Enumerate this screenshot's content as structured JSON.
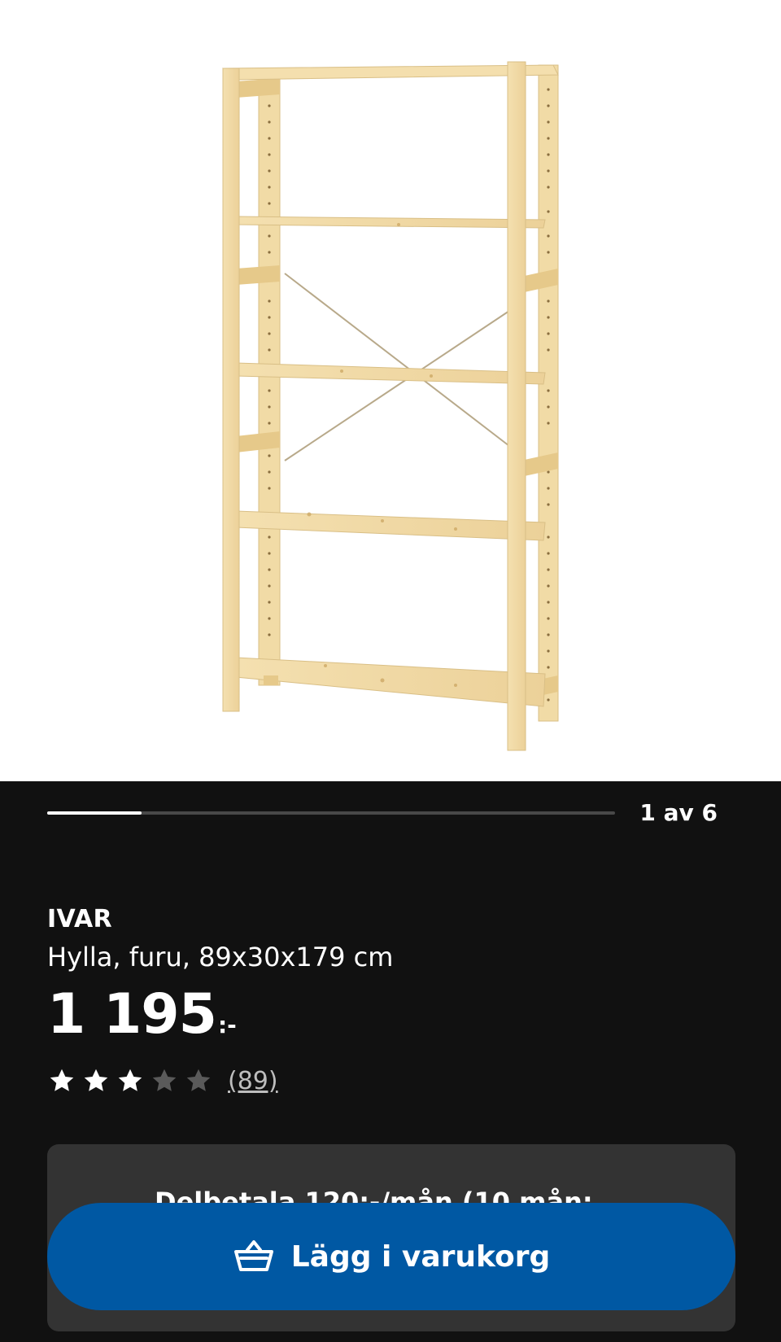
{
  "product_image": {
    "icon": "ivar-shelf-image"
  },
  "carousel": {
    "counter": "1 av 6",
    "current": 1,
    "total": 6
  },
  "product": {
    "brand": "IVAR",
    "description": "Hylla, furu, 89x30x179 cm",
    "price_integer": "1 195",
    "price_suffix": ":-",
    "rating_value": 3,
    "rating_max": 5,
    "review_count": "(89)"
  },
  "installment": {
    "text": "Delbetala 120:-/mån (10 mån;"
  },
  "cart_button": {
    "label": "Lägg i varukorg",
    "icon": "basket-icon"
  },
  "colors": {
    "background": "#111111",
    "button": "#0058a3",
    "card": "#333333",
    "wood": "#f2dca8",
    "star_filled": "#ffffff",
    "star_empty": "#5a5a5a"
  }
}
